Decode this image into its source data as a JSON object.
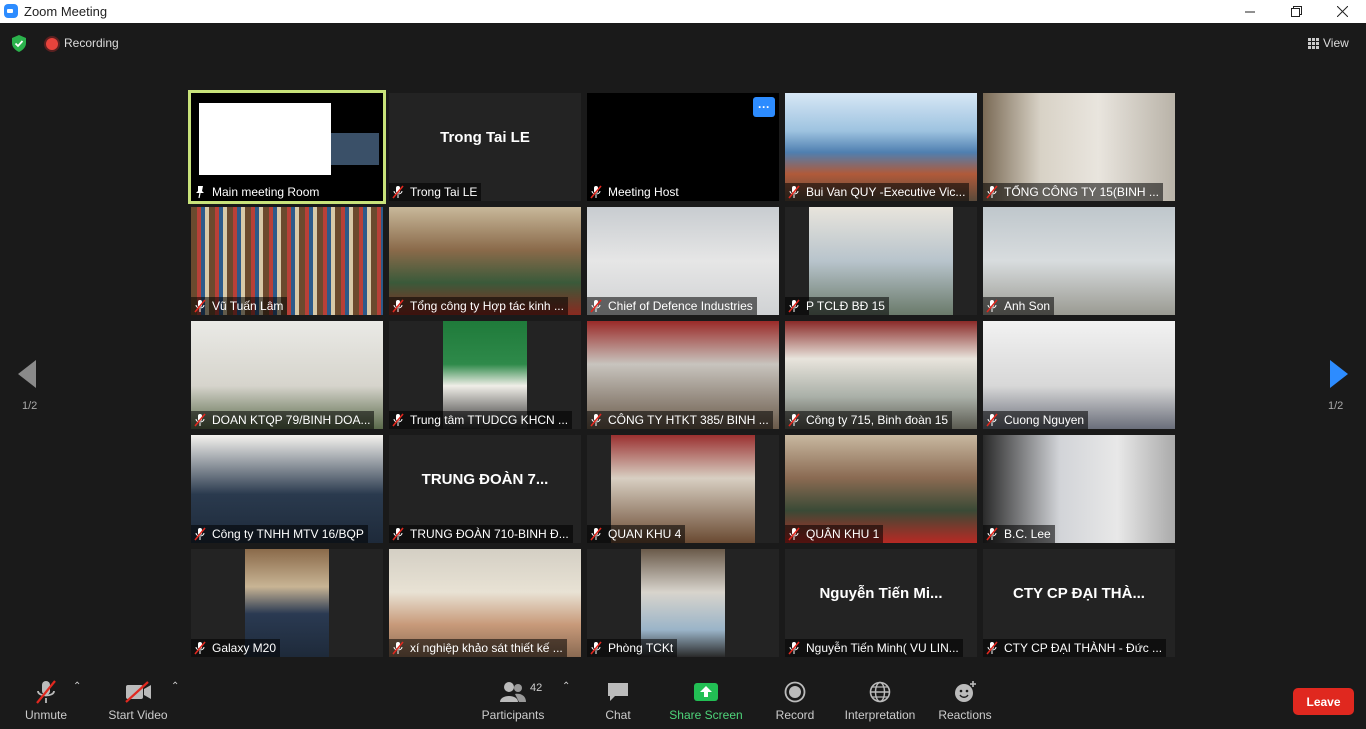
{
  "window": {
    "title": "Zoom Meeting",
    "controls": [
      "minimize-icon",
      "restore-icon",
      "close-icon"
    ]
  },
  "topbar": {
    "recording_label": "Recording",
    "view_label": "View"
  },
  "pager": {
    "left": "1/2",
    "right": "1/2"
  },
  "colors": {
    "accent": "#2d8cff",
    "active_speaker": "#c8e27a",
    "leave": "#e0281f",
    "share": "#22bf54"
  },
  "tiles": [
    {
      "label": "Main meeting Room",
      "big": "",
      "active": true,
      "muted": false
    },
    {
      "label": "Trong Tai LE",
      "big": "Trong Tai LE",
      "active": false,
      "muted": true
    },
    {
      "label": "Meeting Host",
      "big": "",
      "active": false,
      "muted": true
    },
    {
      "label": "Bui Van QUY -Executive Vic...",
      "big": "",
      "active": false,
      "muted": true
    },
    {
      "label": "TỔNG CÔNG TY 15(BINH ...",
      "big": "",
      "active": false,
      "muted": true
    },
    {
      "label": "Vũ Tuấn Lâm",
      "big": "",
      "active": false,
      "muted": true
    },
    {
      "label": "Tổng công ty Hợp tác kinh ...",
      "big": "",
      "active": false,
      "muted": true
    },
    {
      "label": "Chief of Defence Industries",
      "big": "",
      "active": false,
      "muted": true
    },
    {
      "label": "P TCLĐ BĐ 15",
      "big": "",
      "active": false,
      "muted": true
    },
    {
      "label": "Anh Son",
      "big": "",
      "active": false,
      "muted": true
    },
    {
      "label": "DOAN KTQP 79/BINH DOA...",
      "big": "",
      "active": false,
      "muted": true
    },
    {
      "label": "Trung tâm TTUDCG KHCN ...",
      "big": "",
      "active": false,
      "muted": true
    },
    {
      "label": "CÔNG TY HTKT 385/ BINH ...",
      "big": "",
      "active": false,
      "muted": true
    },
    {
      "label": "Công ty 715, Binh đoàn 15",
      "big": "",
      "active": false,
      "muted": true
    },
    {
      "label": "Cuong Nguyen",
      "big": "",
      "active": false,
      "muted": true
    },
    {
      "label": "Công ty TNHH MTV 16/BQP",
      "big": "",
      "active": false,
      "muted": true
    },
    {
      "label": "TRUNG ĐOÀN 710-BINH Đ...",
      "big": "TRUNG ĐOÀN 7...",
      "active": false,
      "muted": true
    },
    {
      "label": "QUAN KHU 4",
      "big": "",
      "active": false,
      "muted": true
    },
    {
      "label": "QUÂN KHU 1",
      "big": "",
      "active": false,
      "muted": true
    },
    {
      "label": "B.C. Lee",
      "big": "",
      "active": false,
      "muted": true
    },
    {
      "label": "Galaxy M20",
      "big": "",
      "active": false,
      "muted": true
    },
    {
      "label": "xí nghiệp khảo sát thiết kế ...",
      "big": "",
      "active": false,
      "muted": true
    },
    {
      "label": "Phòng TCKt",
      "big": "",
      "active": false,
      "muted": true
    },
    {
      "label": "Nguyễn Tiến Minh( VU LIN...",
      "big": "Nguyễn Tiến Mi...",
      "active": false,
      "muted": true
    },
    {
      "label": "CTY CP ĐẠI THÀNH - Đức ...",
      "big": "CTY CP ĐẠI THÀ...",
      "active": false,
      "muted": true
    }
  ],
  "toolbar": {
    "unmute": "Unmute",
    "start_video": "Start Video",
    "participants": "Participants",
    "participants_count": "42",
    "chat": "Chat",
    "share_screen": "Share Screen",
    "record": "Record",
    "interpretation": "Interpretation",
    "reactions": "Reactions",
    "leave": "Leave"
  }
}
